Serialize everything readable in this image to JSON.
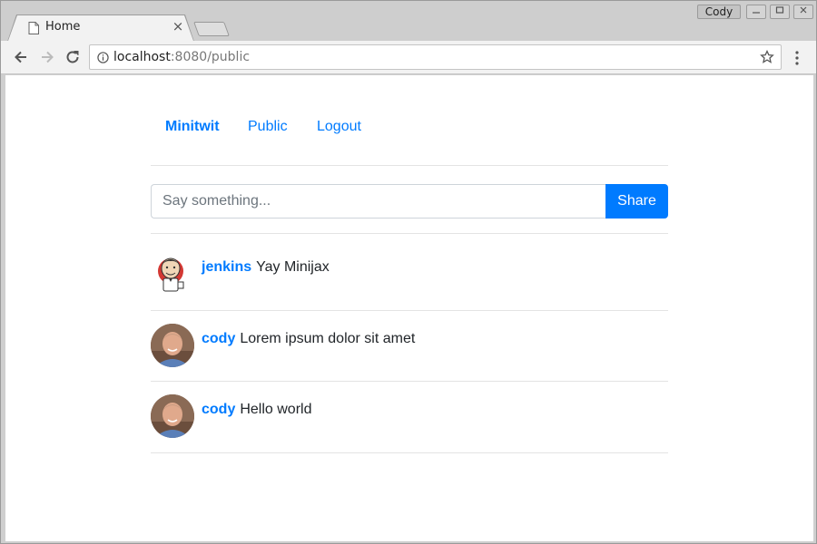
{
  "browser": {
    "tab_title": "Home",
    "tab_close": "×",
    "profile_name": "Cody",
    "url_host": "localhost",
    "url_rest": ":8080/public"
  },
  "nav": {
    "brand": "Minitwit",
    "links": [
      "Public",
      "Logout"
    ]
  },
  "composer": {
    "placeholder": "Say something...",
    "share_label": "Share"
  },
  "messages": [
    {
      "user": "jenkins",
      "text": "Yay Minijax",
      "avatar": "jenkins-mascot"
    },
    {
      "user": "cody",
      "text": "Lorem ipsum dolor sit amet",
      "avatar": "cody-photo"
    },
    {
      "user": "cody",
      "text": "Hello world",
      "avatar": "cody-photo"
    }
  ],
  "colors": {
    "link": "#007bff",
    "button": "#007bff",
    "text": "#212529"
  }
}
